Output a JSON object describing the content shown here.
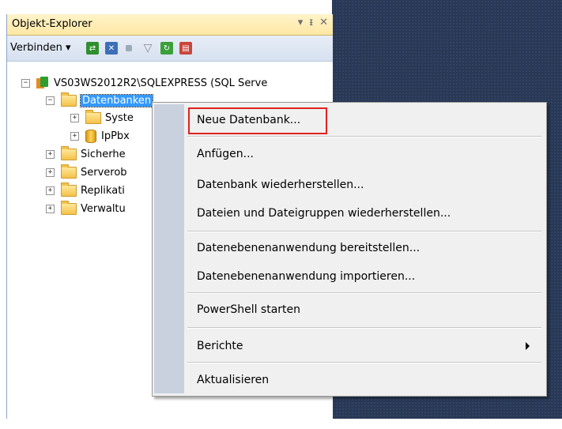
{
  "panel": {
    "title": "Objekt-Explorer",
    "ctrl_dropdown": "▾",
    "ctrl_pin": "ᵖ",
    "ctrl_close": "✕"
  },
  "toolbar": {
    "connect_label": "Verbinden ▾"
  },
  "tree": {
    "server": "VS03WS2012R2\\SQLEXPRESS (SQL Serve",
    "databases": "Datenbanken",
    "system_dbs": "Syste",
    "user_db": "IpPbx",
    "security": "Sicherhe",
    "server_objects": "Serverob",
    "replication": "Replikati",
    "management": "Verwaltu",
    "expanded_glyph": "−",
    "collapsed_glyph": "+"
  },
  "context_menu": {
    "items": [
      "Neue Datenbank...",
      "Anfügen...",
      "Datenbank wiederherstellen...",
      "Dateien und Dateigruppen wiederherstellen...",
      "Datenebenenanwendung bereitstellen...",
      "Datenebenenanwendung importieren...",
      "PowerShell starten",
      "Berichte",
      "Aktualisieren"
    ]
  },
  "colors": {
    "selection": "#3399ff",
    "highlight_border": "#e0221e",
    "background": "#293955"
  }
}
